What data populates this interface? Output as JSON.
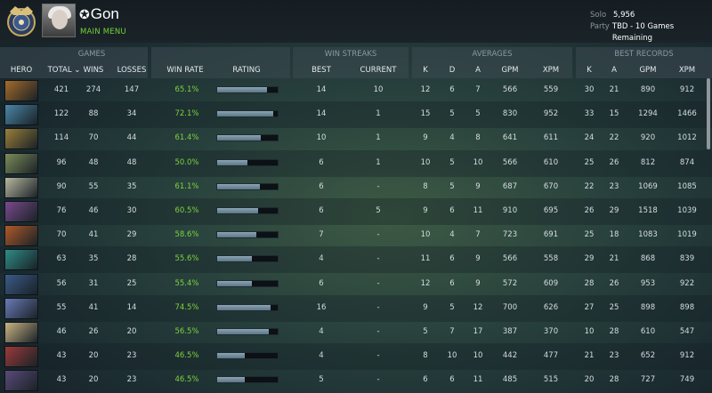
{
  "player": {
    "name": "Gon",
    "name_prefix_icon": "plus-star-icon",
    "menu_link": "MAIN MENU"
  },
  "mmr": {
    "solo_label": "Solo",
    "solo_value": "5,956",
    "party_label": "Party",
    "party_value": "TBD - 10 Games Remaining"
  },
  "groups": {
    "games": "GAMES",
    "win_streaks": "WIN STREAKS",
    "averages": "AVERAGES",
    "best_records": "BEST RECORDS"
  },
  "columns": {
    "hero": "HERO",
    "total": "TOTAL",
    "wins": "WINS",
    "losses": "LOSSES",
    "win_rate": "WIN RATE",
    "rating": "RATING",
    "best": "BEST",
    "current": "CURRENT",
    "k": "K",
    "d": "D",
    "a": "A",
    "gpm": "GPM",
    "xpm": "XPM",
    "bk": "K",
    "ba": "A",
    "bgpm": "GPM",
    "bxpm": "XPM"
  },
  "rows": [
    {
      "hero_color": "#a56a2c",
      "total": "421",
      "wins": "274",
      "losses": "147",
      "win_rate": "65.1%",
      "rating": 0.82,
      "best": "14",
      "current": "10",
      "k": "12",
      "d": "6",
      "a": "7",
      "gpm": "566",
      "xpm": "559",
      "bk": "30",
      "ba": "21",
      "bgpm": "890",
      "bxpm": "912"
    },
    {
      "hero_color": "#4a86a8",
      "total": "122",
      "wins": "88",
      "losses": "34",
      "win_rate": "72.1%",
      "rating": 0.92,
      "best": "14",
      "current": "1",
      "k": "15",
      "d": "5",
      "a": "5",
      "gpm": "830",
      "xpm": "952",
      "bk": "33",
      "ba": "15",
      "bgpm": "1294",
      "bxpm": "1466"
    },
    {
      "hero_color": "#9a7f3a",
      "total": "114",
      "wins": "70",
      "losses": "44",
      "win_rate": "61.4%",
      "rating": 0.72,
      "best": "10",
      "current": "1",
      "k": "9",
      "d": "4",
      "a": "8",
      "gpm": "641",
      "xpm": "611",
      "bk": "24",
      "ba": "22",
      "bgpm": "920",
      "bxpm": "1012"
    },
    {
      "hero_color": "#7c8c5a",
      "total": "96",
      "wins": "48",
      "losses": "48",
      "win_rate": "50.0%",
      "rating": 0.5,
      "best": "6",
      "current": "1",
      "k": "10",
      "d": "5",
      "a": "10",
      "gpm": "566",
      "xpm": "610",
      "bk": "25",
      "ba": "26",
      "bgpm": "812",
      "bxpm": "874"
    },
    {
      "hero_color": "#b8b7a0",
      "total": "90",
      "wins": "55",
      "losses": "35",
      "win_rate": "61.1%",
      "rating": 0.7,
      "best": "6",
      "current": "-",
      "k": "8",
      "d": "5",
      "a": "9",
      "gpm": "687",
      "xpm": "670",
      "bk": "22",
      "ba": "23",
      "bgpm": "1069",
      "bxpm": "1085"
    },
    {
      "hero_color": "#7a4a8c",
      "total": "76",
      "wins": "46",
      "losses": "30",
      "win_rate": "60.5%",
      "rating": 0.68,
      "best": "6",
      "current": "5",
      "k": "9",
      "d": "6",
      "a": "11",
      "gpm": "910",
      "xpm": "695",
      "bk": "26",
      "ba": "29",
      "bgpm": "1518",
      "bxpm": "1039"
    },
    {
      "hero_color": "#b0592a",
      "total": "70",
      "wins": "41",
      "losses": "29",
      "win_rate": "58.6%",
      "rating": 0.65,
      "best": "7",
      "current": "-",
      "k": "10",
      "d": "4",
      "a": "7",
      "gpm": "723",
      "xpm": "691",
      "bk": "25",
      "ba": "18",
      "bgpm": "1083",
      "bxpm": "1019"
    },
    {
      "hero_color": "#2e8c86",
      "total": "63",
      "wins": "35",
      "losses": "28",
      "win_rate": "55.6%",
      "rating": 0.58,
      "best": "4",
      "current": "-",
      "k": "11",
      "d": "6",
      "a": "9",
      "gpm": "566",
      "xpm": "558",
      "bk": "29",
      "ba": "21",
      "bgpm": "868",
      "bxpm": "839"
    },
    {
      "hero_color": "#3a5a88",
      "total": "56",
      "wins": "31",
      "losses": "25",
      "win_rate": "55.4%",
      "rating": 0.58,
      "best": "6",
      "current": "-",
      "k": "12",
      "d": "6",
      "a": "9",
      "gpm": "572",
      "xpm": "609",
      "bk": "28",
      "ba": "26",
      "bgpm": "953",
      "bxpm": "922"
    },
    {
      "hero_color": "#6a7ab8",
      "total": "55",
      "wins": "41",
      "losses": "14",
      "win_rate": "74.5%",
      "rating": 0.88,
      "best": "16",
      "current": "-",
      "k": "9",
      "d": "5",
      "a": "12",
      "gpm": "700",
      "xpm": "626",
      "bk": "27",
      "ba": "25",
      "bgpm": "898",
      "bxpm": "898"
    },
    {
      "hero_color": "#c9b384",
      "total": "46",
      "wins": "26",
      "losses": "20",
      "win_rate": "56.5%",
      "rating": 0.85,
      "best": "4",
      "current": "-",
      "k": "5",
      "d": "7",
      "a": "17",
      "gpm": "387",
      "xpm": "370",
      "bk": "10",
      "ba": "28",
      "bgpm": "610",
      "bxpm": "547"
    },
    {
      "hero_color": "#9c3a3a",
      "total": "43",
      "wins": "20",
      "losses": "23",
      "win_rate": "46.5%",
      "rating": 0.45,
      "best": "4",
      "current": "-",
      "k": "8",
      "d": "10",
      "a": "10",
      "gpm": "442",
      "xpm": "477",
      "bk": "21",
      "ba": "23",
      "bgpm": "652",
      "bxpm": "912"
    },
    {
      "hero_color": "#5a4a7a",
      "total": "43",
      "wins": "20",
      "losses": "23",
      "win_rate": "46.5%",
      "rating": 0.45,
      "best": "5",
      "current": "-",
      "k": "6",
      "d": "6",
      "a": "11",
      "gpm": "485",
      "xpm": "515",
      "bk": "20",
      "ba": "28",
      "bgpm": "727",
      "bxpm": "749"
    }
  ]
}
